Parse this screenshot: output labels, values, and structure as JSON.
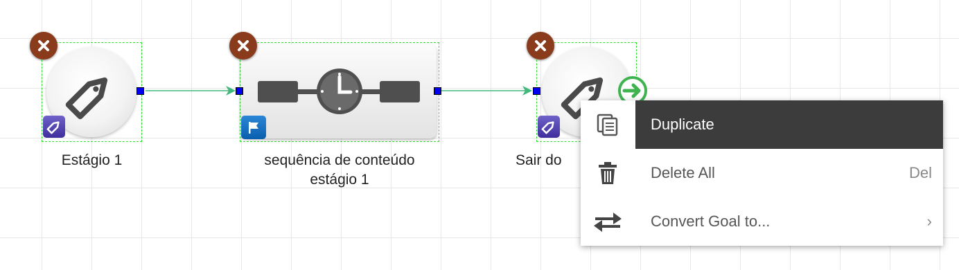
{
  "nodes": [
    {
      "label": "Estágio 1",
      "type": "goal",
      "icon": "tag-icon",
      "badge": "tag-badge-icon"
    },
    {
      "label_line1": "sequência de conteúdo",
      "label_line2": "estágio 1",
      "type": "wait",
      "icon": "clock-timeline-icon",
      "badge": "flag-badge-icon"
    },
    {
      "label": "Sair do",
      "type": "goal",
      "icon": "tag-icon",
      "badge": "tag-badge-icon",
      "extra_icon": "exit-arrow-icon"
    }
  ],
  "context_menu": {
    "items": [
      {
        "label": "Duplicate",
        "icon": "duplicate-icon",
        "shortcut": "",
        "active": true
      },
      {
        "label": "Delete All",
        "icon": "trash-icon",
        "shortcut": "Del",
        "active": false
      },
      {
        "label": "Convert Goal to...",
        "icon": "swap-arrows-icon",
        "shortcut": "›",
        "active": false
      }
    ]
  },
  "colors": {
    "close_button": "#8a3b1c",
    "port": "#0000ee",
    "selection": "#2ee02e",
    "connector": "#3fb87a",
    "menu_highlight": "#3c3c3c"
  }
}
